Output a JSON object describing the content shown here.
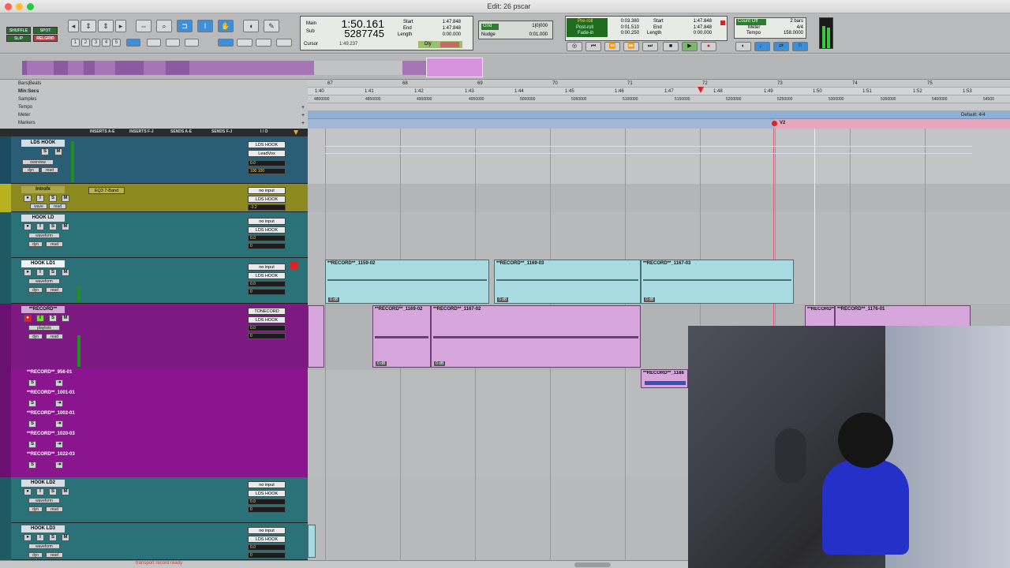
{
  "window": {
    "title": "Edit: 26 pscar"
  },
  "modes": {
    "shuffle": "SHUFFLE",
    "spot": "SPOT",
    "slip": "SLIP",
    "grid": "RELGRID"
  },
  "zoom_presets": [
    "1",
    "2",
    "3",
    "4",
    "5"
  ],
  "counters": {
    "main_label": "Main",
    "sub_label": "Sub",
    "main_value": "1:50.161",
    "sub_value": "5287745",
    "cursor_label": "Cursor",
    "cursor_value": "1:49.237",
    "start_label": "Start",
    "end_label": "End",
    "length_label": "Length",
    "start_value": "1:47.848",
    "end_value": "1:47.848",
    "length_value": "0:00.000",
    "dly_label": "Dly"
  },
  "grid": {
    "grid_label": "Grid",
    "grid_value": "1|0|000",
    "nudge_label": "Nudge",
    "nudge_value": "0:01.000"
  },
  "transport_counters": {
    "preroll_label": "Pre-roll",
    "postroll_label": "Post-roll",
    "fadein_label": "Fade-in",
    "preroll_value": "0:03.380",
    "postroll_value": "0:01.510",
    "fadein_value": "0:00.250",
    "start_label": "Start",
    "end_label": "End",
    "length_label": "Length",
    "start_value": "1:47.848",
    "end_value": "1:47.848",
    "length_value": "0:00.000"
  },
  "midi": {
    "countoff_label": "Count Off",
    "countoff_value": "2 bars",
    "meter_label": "Meter",
    "meter_value": "4/4",
    "tempo_label": "Tempo",
    "tempo_value": "158.0000"
  },
  "rulers": {
    "labels": [
      "Bars|Beats",
      "Min:Secs",
      "Samples",
      "Tempo",
      "Meter",
      "Markers"
    ],
    "bars": [
      "67",
      "68",
      "69",
      "70",
      "71",
      "72",
      "73",
      "74",
      "75"
    ],
    "mins": [
      "1:40",
      "1:41",
      "1:42",
      "1:43",
      "1:44",
      "1:45",
      "1:46",
      "1:47",
      "1:48",
      "1:49",
      "1:50",
      "1:51",
      "1:52",
      "1:53"
    ],
    "samples": [
      "4800000",
      "4850000",
      "4900000",
      "4950000",
      "5000000",
      "5050000",
      "5100000",
      "5150000",
      "5200000",
      "5250000",
      "5300000",
      "5350000",
      "5400000",
      "54500"
    ],
    "meter_default": "Default: 4/4",
    "marker": "V2"
  },
  "column_headers": [
    "INSERTS A-E",
    "INSERTS F-J",
    "SENDS A-E",
    "SENDS F-J",
    "I / O"
  ],
  "tracks": [
    {
      "name": "LDS HOOK",
      "view": "overview",
      "mode": "read",
      "in": "LDS HOOK",
      "out": "LeadVox",
      "vol": "0.0",
      "pan": "100 100"
    },
    {
      "name": "Introfx",
      "view": "wave",
      "mode": "read",
      "insert": "EQ3 7-Band",
      "in": "no input",
      "out": "LDS HOOK",
      "vol": "-3.2",
      "pan": "0"
    },
    {
      "name": "HOOK LD",
      "view": "waveform",
      "mode": "read",
      "in": "no input",
      "out": "LDS HOOK",
      "vol": "0.0",
      "pan": "0"
    },
    {
      "name": "HOOK LD1",
      "view": "waveform",
      "mode": "read",
      "in": "no input",
      "out": "LDS HOOK",
      "vol": "0.0",
      "pan": "0"
    },
    {
      "name": "**RECORD**",
      "view": "playlists",
      "mode": "read",
      "in": "TONECORD",
      "out": "LDS HOOK",
      "vol": "0.0",
      "pan": "0"
    },
    {
      "name": "HOOK LD2",
      "view": "waveform",
      "mode": "read",
      "in": "no input",
      "out": "LDS HOOK",
      "vol": "0.0",
      "pan": "0"
    },
    {
      "name": "HOOK LD3",
      "view": "waveform",
      "mode": "read",
      "in": "no input",
      "out": "LDS HOOK",
      "vol": "0.0",
      "pan": "0"
    }
  ],
  "playlists": [
    "**RECORD**_956-01",
    "**RECORD**_1001-01",
    "**RECORD**_1002-01",
    "**RECORD**_1020-03",
    "**RECORD**_1022-03"
  ],
  "clips": {
    "ld1": [
      "**RECORD**_1159-02",
      "**RECORD**_1169-03",
      "**RECORD**_1167-03"
    ],
    "rec": [
      "**RECORD**_1169-02",
      "**RECORD**_1167-02",
      "**RECORD**_1176-01",
      "**RECORD**_1169",
      "**RECORD**_1188"
    ],
    "gain": "0 dB"
  },
  "status": "transport record ready",
  "colors": {
    "blue_clip": "#a9dce2",
    "purple_clip": "#d7a6dc",
    "playlist_bg": "#8a1a8a",
    "yellow_track": "#8c8a1e",
    "teal_track": "#2a7178"
  }
}
